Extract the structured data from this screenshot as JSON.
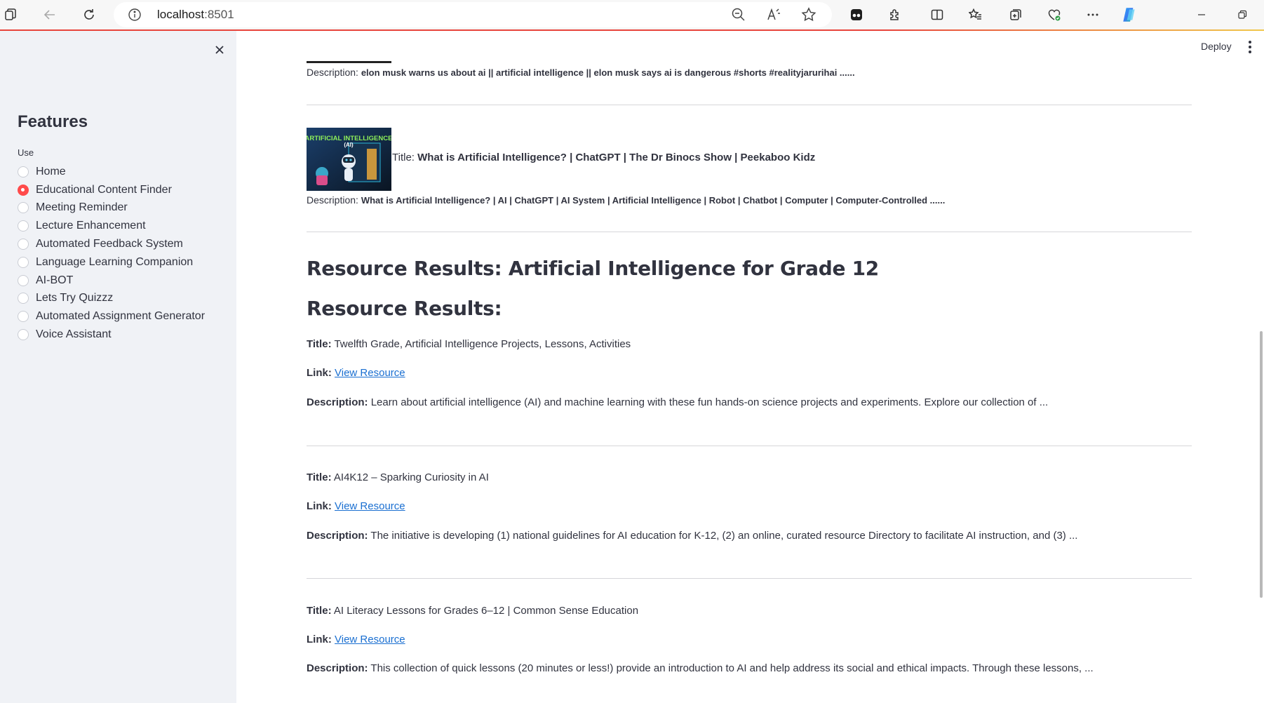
{
  "browser": {
    "url_host": "localhost",
    "url_port": ":8501"
  },
  "sidebar": {
    "title": "Features",
    "radio_label": "Use",
    "options": [
      {
        "label": "Home",
        "selected": false
      },
      {
        "label": "Educational Content Finder",
        "selected": true
      },
      {
        "label": "Meeting Reminder",
        "selected": false
      },
      {
        "label": "Lecture Enhancement",
        "selected": false
      },
      {
        "label": "Automated Feedback System",
        "selected": false
      },
      {
        "label": "Language Learning Companion",
        "selected": false
      },
      {
        "label": "AI-BOT",
        "selected": false
      },
      {
        "label": "Lets Try Quizzz",
        "selected": false
      },
      {
        "label": "Automated Assignment Generator",
        "selected": false
      },
      {
        "label": "Voice Assistant",
        "selected": false
      }
    ]
  },
  "header": {
    "deploy_label": "Deploy"
  },
  "videos": [
    {
      "description_prefix": "Description: ",
      "description": "elon musk warns us about ai || artificial intelligence || elon musk says ai is dangerous #shorts #realityjarurihai ......"
    },
    {
      "title_prefix": "Title: ",
      "title": "What is Artificial Intelligence? | ChatGPT | The Dr Binocs Show | Peekaboo Kidz",
      "thumbnail_text": "ARTIFICIAL INTELLIGENCE",
      "thumbnail_subtext": "(AI)",
      "description_prefix": "Description: ",
      "description": "What is Artificial Intelligence? | AI | ChatGPT | AI System | Artificial Intelligence | Robot | Chatbot | Computer | Computer-Controlled ......"
    }
  ],
  "resources": {
    "heading_topic": "Resource Results: Artificial Intelligence for Grade 12",
    "heading": "Resource Results:",
    "title_label": "Title:",
    "link_label": "Link:",
    "description_label": "Description:",
    "link_text": "View Resource",
    "items": [
      {
        "title": "Twelfth Grade, Artificial Intelligence Projects, Lessons, Activities",
        "description": "Learn about artificial intelligence (AI) and machine learning with these fun hands-on science projects and experiments. Explore our collection of ..."
      },
      {
        "title": "AI4K12 – Sparking Curiosity in AI",
        "description": "The initiative is developing (1) national guidelines for AI education for K-12, (2) an online, curated resource Directory to facilitate AI instruction, and (3) ..."
      },
      {
        "title": "AI Literacy Lessons for Grades 6–12 | Common Sense Education",
        "description": "This collection of quick lessons (20 minutes or less!) provide an introduction to AI and help address its social and ethical impacts. Through these lessons, ..."
      }
    ]
  },
  "colors": {
    "accent": "#ff4b4b",
    "link": "#1a6fd1",
    "sidebar_bg": "#f0f2f6"
  }
}
